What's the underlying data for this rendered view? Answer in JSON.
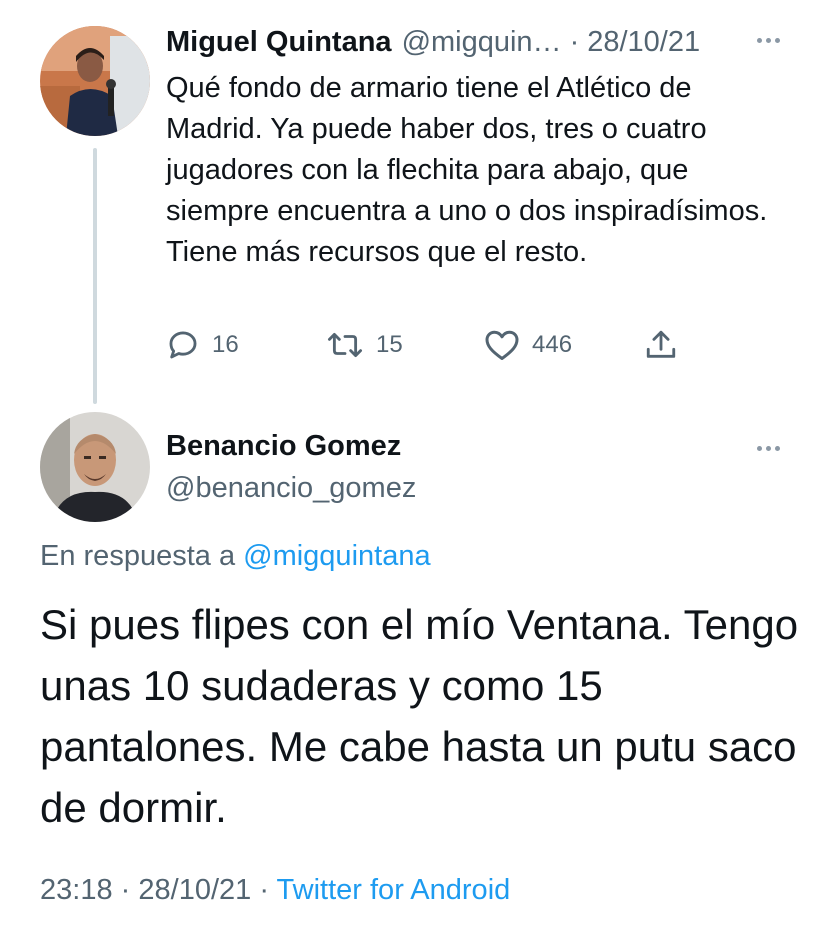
{
  "colors": {
    "text": "#0f1419",
    "secondary": "#536471",
    "link": "#1d9bf0",
    "thread_line": "#cfd9de"
  },
  "parent_tweet": {
    "name": "Miguel Quintana",
    "handle": "@migquin…",
    "separator": "·",
    "date": "28/10/21",
    "text": "Qué fondo de armario tiene el Atlético de Madrid. Ya puede haber dos, tres o cuatro jugadores con la flechita para abajo, que siempre encuentra a uno o dos inspiradísimos. Tiene más recursos que el resto.",
    "actions": {
      "reply_icon": "reply-icon",
      "reply_count": "16",
      "retweet_icon": "retweet-icon",
      "retweet_count": "15",
      "like_icon": "heart-icon",
      "like_count": "446",
      "share_icon": "share-icon"
    }
  },
  "reply_tweet": {
    "name": "Benancio Gomez",
    "handle": "@benancio_gomez",
    "replying_prefix": "En respuesta a",
    "replying_to": "@migquintana",
    "text": "Si pues flipes con el mío Ventana. Tengo unas 10 sudaderas y como 15 pantalones. Me cabe hasta un putu saco de dormir.",
    "time": "23:18",
    "separator": "·",
    "date": "28/10/21",
    "source": "Twitter for Android"
  }
}
